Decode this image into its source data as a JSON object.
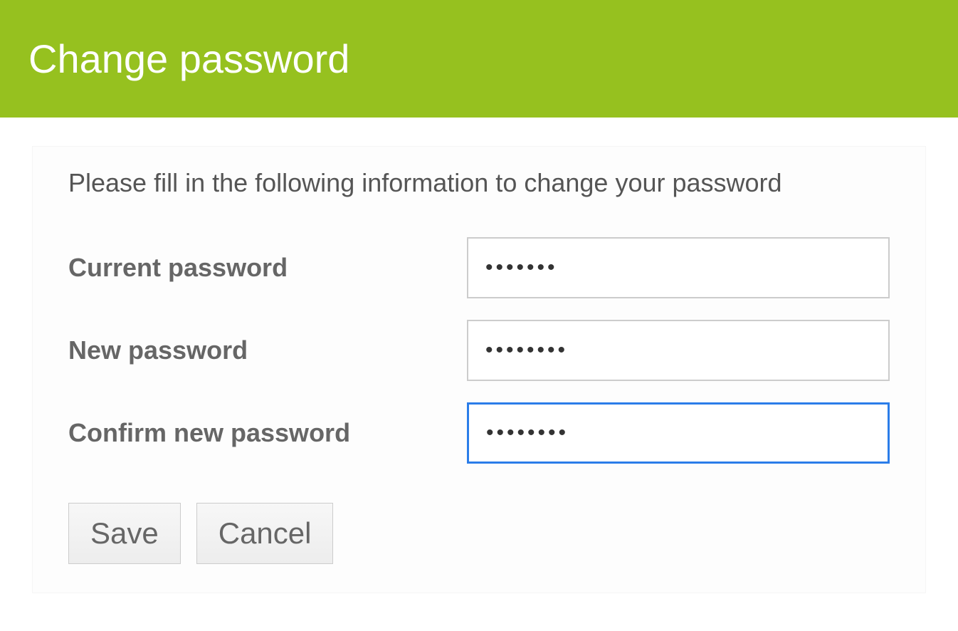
{
  "header": {
    "title": "Change password"
  },
  "form": {
    "instruction": "Please fill in the following information to change your password",
    "fields": {
      "current_password": {
        "label": "Current password",
        "value": "1234567"
      },
      "new_password": {
        "label": "New password",
        "value": "12345678"
      },
      "confirm_password": {
        "label": "Confirm new password",
        "value": "12345678"
      }
    },
    "buttons": {
      "save": "Save",
      "cancel": "Cancel"
    }
  }
}
